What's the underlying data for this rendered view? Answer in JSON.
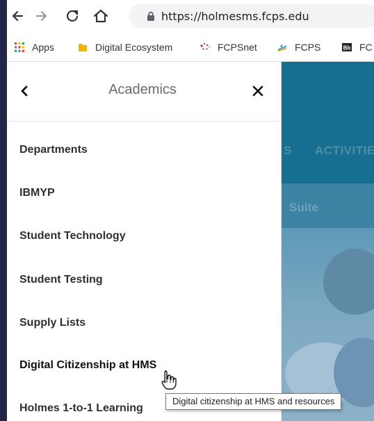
{
  "browser": {
    "url": "https://holmesms.fcps.edu",
    "bookmarks": [
      {
        "label": "Apps",
        "icon": "apps-grid-icon"
      },
      {
        "label": "Digital Ecosystem",
        "icon": "bookmark-folder-icon"
      },
      {
        "label": "FCPSnet",
        "icon": "fcpsnet-dots-icon"
      },
      {
        "label": "FCPS",
        "icon": "fcps-logo-icon"
      },
      {
        "label": "FC",
        "icon": "blackboard-icon"
      }
    ]
  },
  "background_page": {
    "nav_items": [
      "S",
      "ACTIVITIE"
    ],
    "band_text": "Suite"
  },
  "drawer": {
    "title": "Academics",
    "items": [
      {
        "label": "Departments"
      },
      {
        "label": "IBMYP"
      },
      {
        "label": "Student Technology"
      },
      {
        "label": "Student Testing"
      },
      {
        "label": "Supply Lists"
      },
      {
        "label": "Digital Citizenship at HMS"
      },
      {
        "label": "Holmes 1-to-1 Learning"
      }
    ]
  },
  "tooltip": {
    "text": "Digital citizenship at HMS and resources"
  },
  "colors": {
    "frame": "#23264a",
    "page_blue": "#176f8f",
    "band_blue": "#3c82a3"
  }
}
